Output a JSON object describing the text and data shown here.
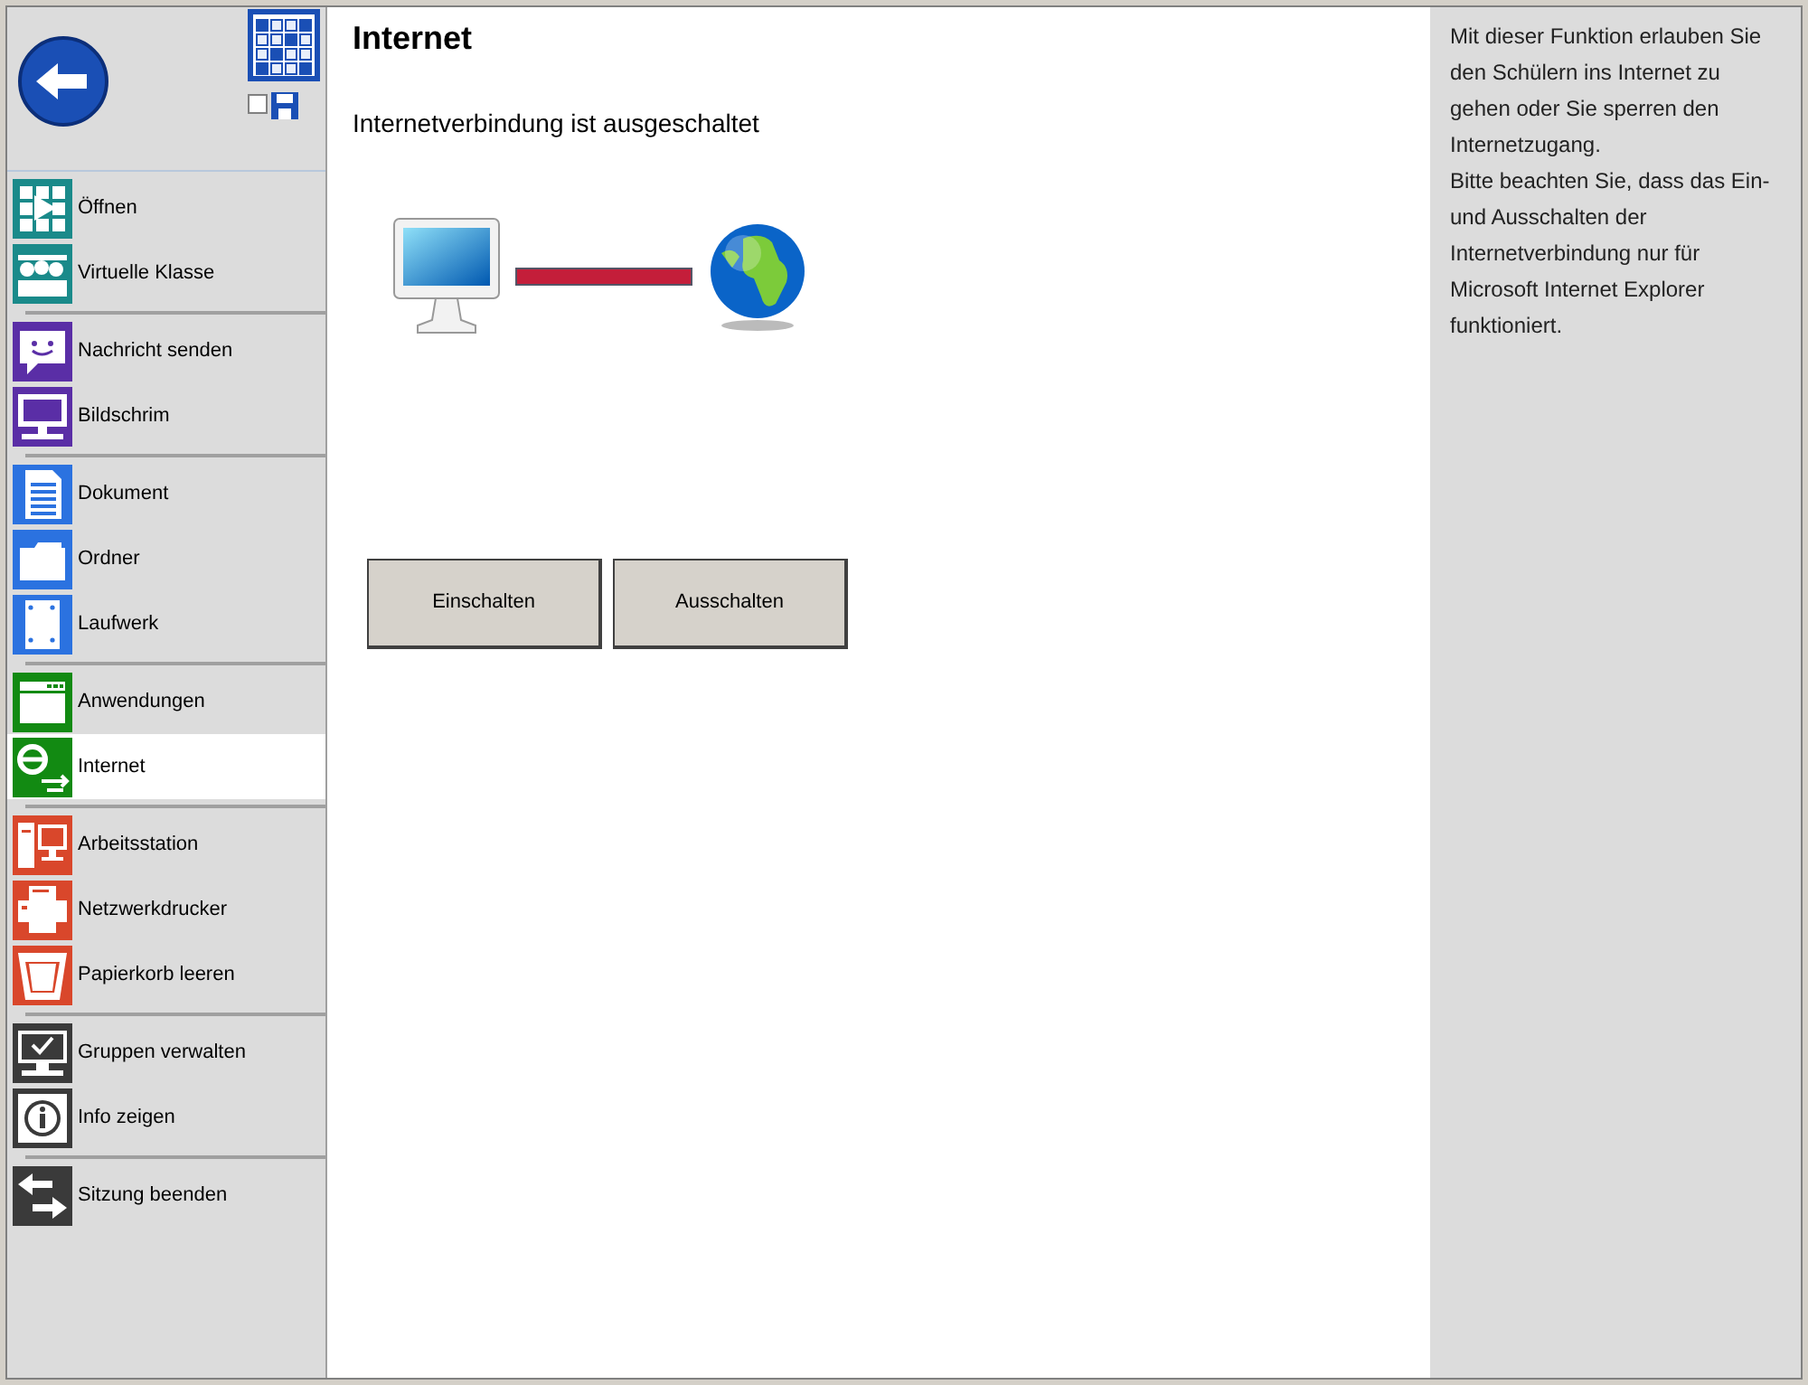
{
  "toolbar": {
    "remember_checked": false
  },
  "sidebar": {
    "groups": [
      {
        "items": [
          {
            "label": "Öffnen",
            "color": "#1a8a8a",
            "selected": false
          },
          {
            "label": "Virtuelle Klasse",
            "color": "#1a8a8a",
            "selected": false
          }
        ]
      },
      {
        "items": [
          {
            "label": "Nachricht senden",
            "color": "#5a2ea6",
            "selected": false
          },
          {
            "label": "Bildschrim",
            "color": "#5a2ea6",
            "selected": false
          }
        ]
      },
      {
        "items": [
          {
            "label": "Dokument",
            "color": "#2b72e0",
            "selected": false
          },
          {
            "label": "Ordner",
            "color": "#2b72e0",
            "selected": false
          },
          {
            "label": "Laufwerk",
            "color": "#2b72e0",
            "selected": false
          }
        ]
      },
      {
        "items": [
          {
            "label": "Anwendungen",
            "color": "#128a12",
            "selected": false
          },
          {
            "label": "Internet",
            "color": "#128a12",
            "selected": true
          }
        ]
      },
      {
        "items": [
          {
            "label": "Arbeitsstation",
            "color": "#d9472b",
            "selected": false
          },
          {
            "label": "Netzwerkdrucker",
            "color": "#d9472b",
            "selected": false
          },
          {
            "label": "Papierkorb leeren",
            "color": "#d9472b",
            "selected": false
          }
        ]
      },
      {
        "items": [
          {
            "label": "Gruppen verwalten",
            "color": "#3a3a3a",
            "selected": false
          },
          {
            "label": "Info zeigen",
            "color": "#3a3a3a",
            "selected": false
          }
        ]
      },
      {
        "items": [
          {
            "label": "Sitzung beenden",
            "color": "#3a3a3a",
            "selected": false
          }
        ]
      }
    ]
  },
  "main": {
    "title": "Internet",
    "status": "Internetverbindung ist ausgeschaltet",
    "connected": false,
    "buttons": [
      "Einschalten",
      "Ausschalten"
    ]
  },
  "help": {
    "lines": [
      "Mit dieser Funktion erlauben Sie den Schülern ins Internet zu gehen oder Sie sperren den Internetzugang.",
      "Bitte beachten Sie, dass das Ein- und Ausschalten der Internetverbindung nur für Microsoft Internet Explorer funktioniert."
    ]
  }
}
